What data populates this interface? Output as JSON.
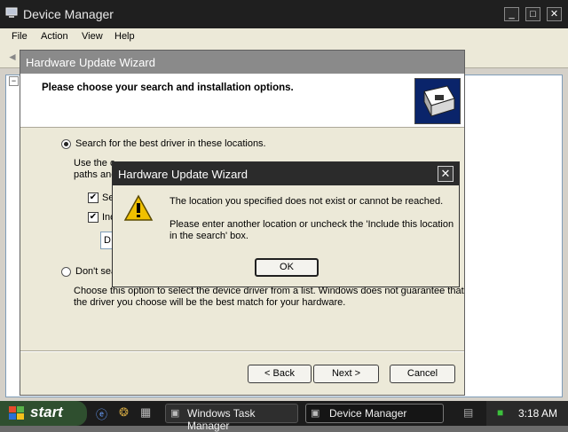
{
  "colors": {
    "desktop": "#6b6b6b",
    "titlebar_dark": "#1f1f1f",
    "dialog_face": "#ece9d8",
    "warning_yellow": "#f0c000"
  },
  "device_manager": {
    "title": "Device Manager",
    "menu": [
      "File",
      "Action",
      "View",
      "Help"
    ],
    "tree_collapse_glyph": "−"
  },
  "wizard": {
    "title": "Hardware Update Wizard",
    "header_title": "Please choose your search and installation options.",
    "option_search_label": "Search for the best driver in these locations.",
    "option_search_desc_line1": "Use the c",
    "option_search_desc_line2": "paths and",
    "check_removable_label": "Se",
    "check_include_label": "Inc",
    "location_value": "D:",
    "option_dont_search_label": "Don't sea",
    "option_dont_search_desc_line1": "Choose this option to select the device driver from a list.  Windows does not guarantee that",
    "option_dont_search_desc_line2": "the driver you choose will be the best match for your hardware.",
    "back_button": "< Back",
    "next_button": "Next >",
    "cancel_button": "Cancel"
  },
  "error_dialog": {
    "title": "Hardware Update Wizard",
    "message_line1": "The location you specified does not exist or cannot be reached.",
    "message_line2": "Please enter another location or uncheck the 'Include this location",
    "message_line3": "in the search' box.",
    "ok_button": "OK",
    "icon": "warning-icon"
  },
  "taskbar": {
    "start_label": "start",
    "tasks": [
      "Windows Task Manager",
      "Device Manager"
    ],
    "active_task": "Device Manager",
    "clock": "3:18 AM"
  }
}
